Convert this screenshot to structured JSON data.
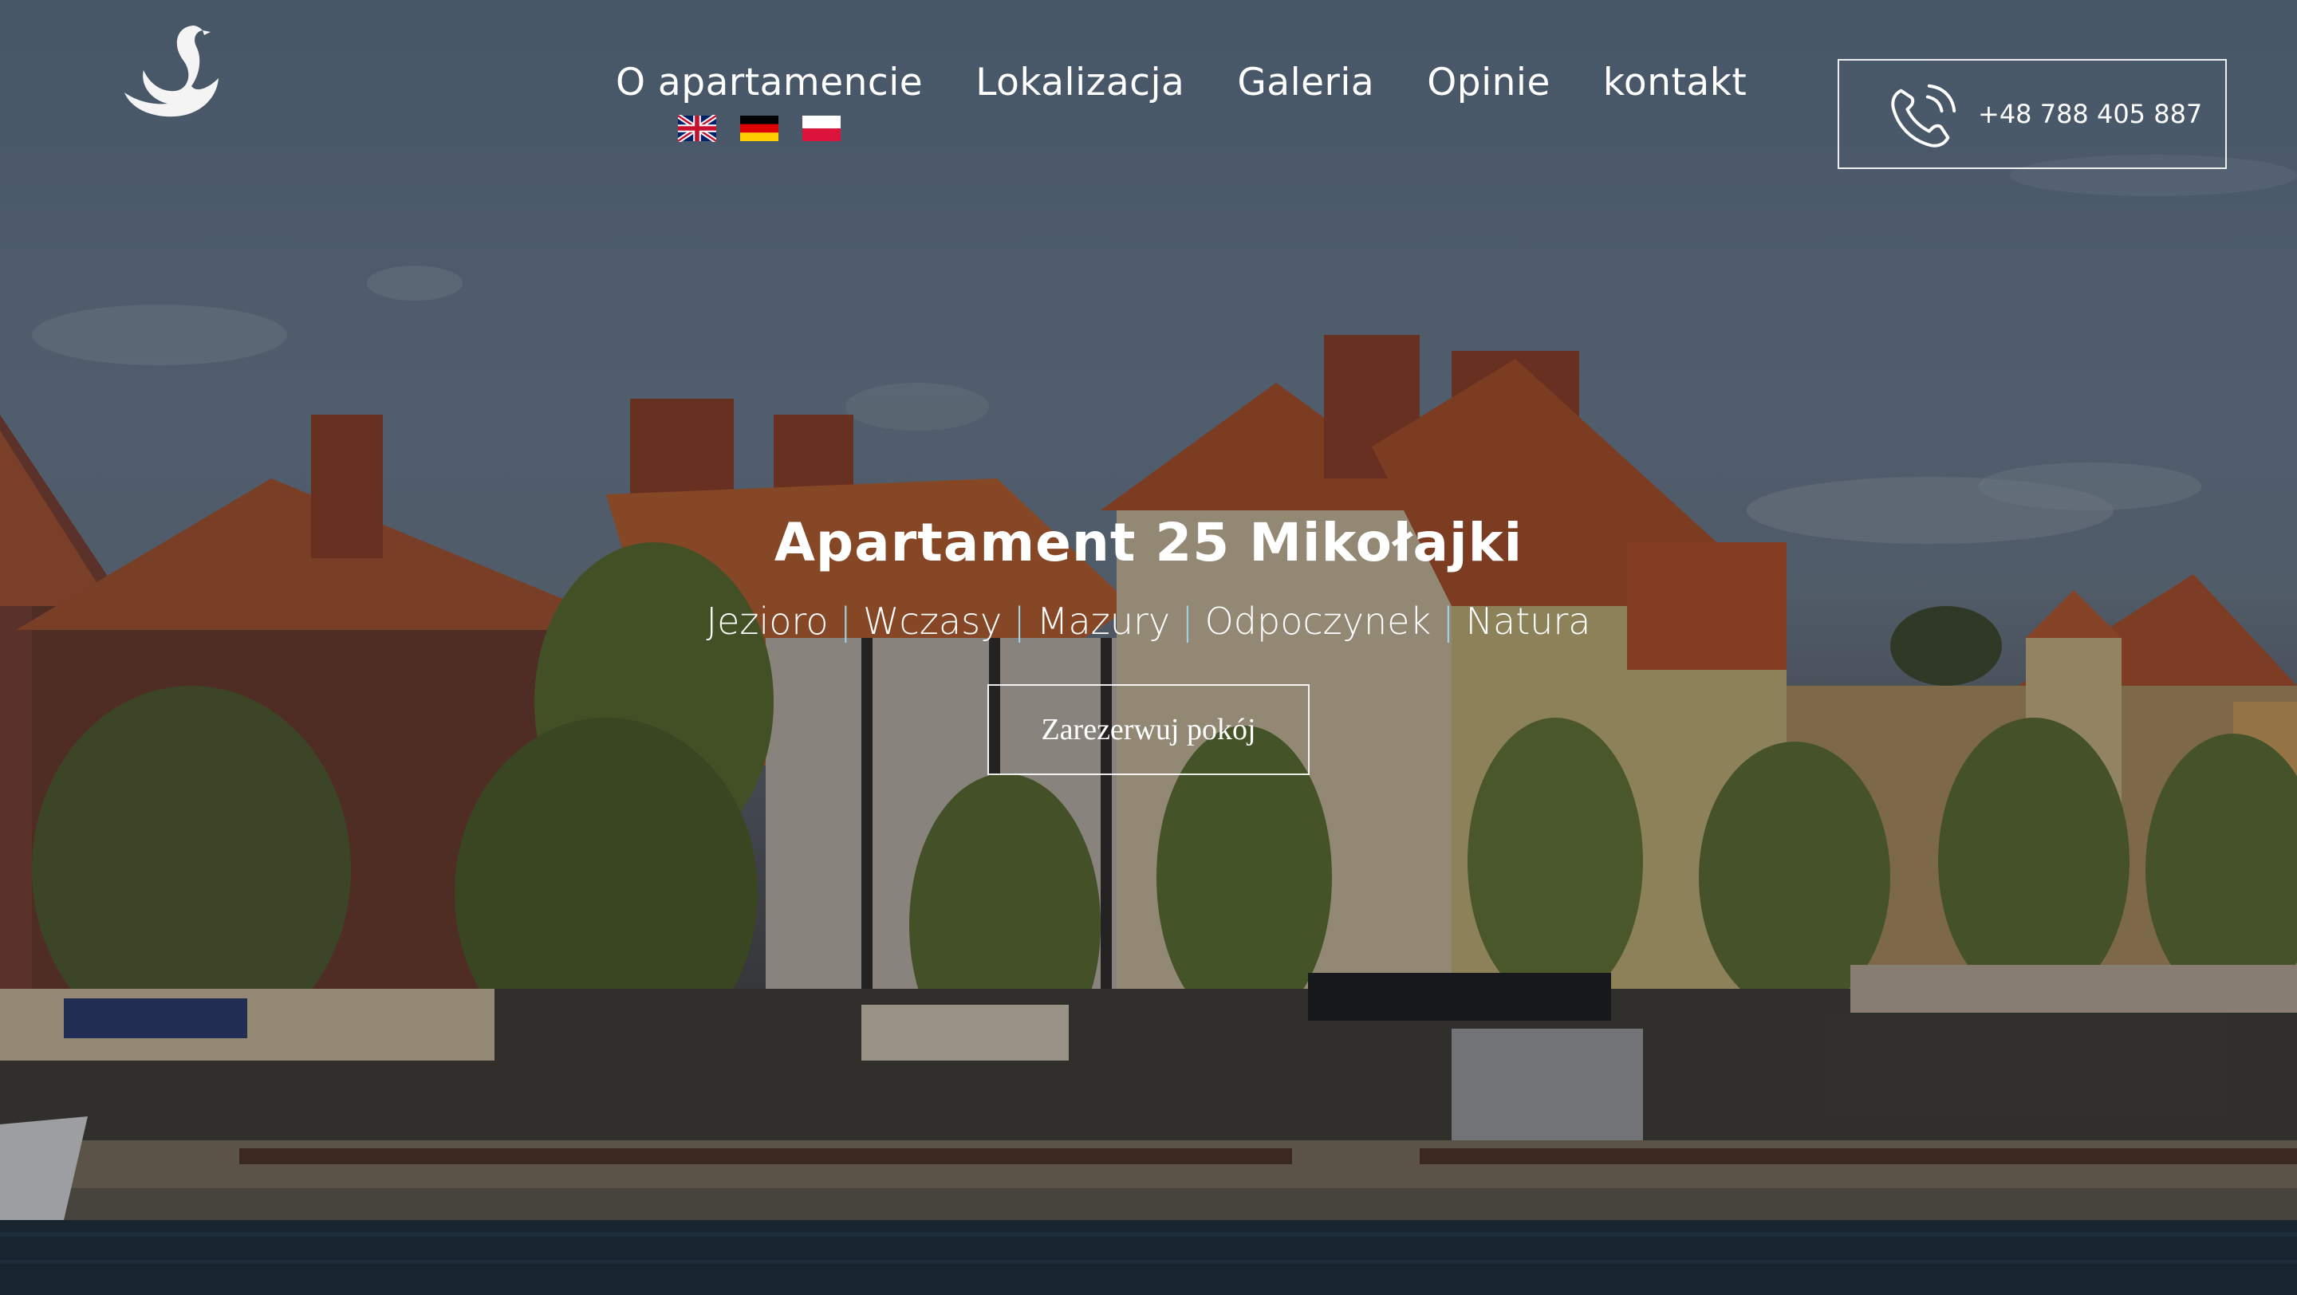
{
  "nav": {
    "items": [
      {
        "label": "O apartamencie"
      },
      {
        "label": "Lokalizacja"
      },
      {
        "label": "Galeria"
      },
      {
        "label": "Opinie"
      },
      {
        "label": "kontakt"
      }
    ]
  },
  "languages": [
    {
      "name": "uk-flag-icon"
    },
    {
      "name": "de-flag-icon"
    },
    {
      "name": "pl-flag-icon"
    }
  ],
  "contact": {
    "phone": "+48 788 405 887",
    "icon": "phone-icon"
  },
  "hero": {
    "title": "Apartament 25 Mikołajki",
    "tags": [
      "Jezioro",
      "Wczasy",
      "Mazury",
      "Odpoczynek",
      "Natura"
    ],
    "separator": "|",
    "cta_label": "Zarezerwuj pokój"
  },
  "colors": {
    "separator": "#9fd0e6",
    "text": "#ffffff"
  }
}
